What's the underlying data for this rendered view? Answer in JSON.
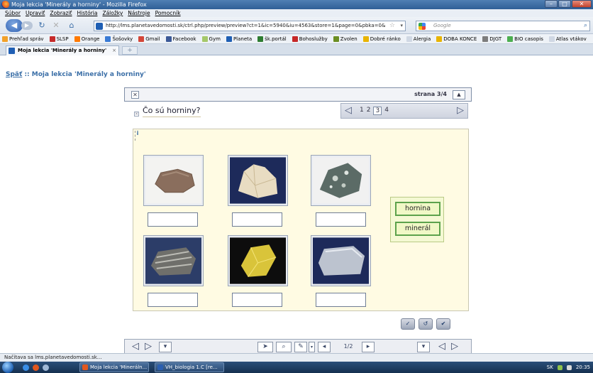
{
  "window": {
    "title": "Moja lekcia 'Minerály a horniny' - Mozilla Firefox",
    "min_btn": "–",
    "max_btn": "□",
    "close_btn": "✕"
  },
  "menu": [
    "Súbor",
    "Upraviť",
    "Zobraziť",
    "História",
    "Záložky",
    "Nástroje",
    "Pomocník"
  ],
  "nav": {
    "url": "http://lms.planetavedomosti.sk/ctrl.php/preview/preview?ct=1&ic=5940&iu=4563&store=1&page=0&pbka=0&",
    "search_placeholder": "Google"
  },
  "bookmarks": [
    {
      "label": "Prehľad správ",
      "color": "#f2a12a"
    },
    {
      "label": "SLSP",
      "color": "#c62a2a"
    },
    {
      "label": "Orange",
      "color": "#ff7a00"
    },
    {
      "label": "Šošovky",
      "color": "#3a7bd5"
    },
    {
      "label": "Gmail",
      "color": "#d44638"
    },
    {
      "label": "Facebook",
      "color": "#3b5998"
    },
    {
      "label": "Gym",
      "color": "#a5c86a"
    },
    {
      "label": "Planeta",
      "color": "#1f5fb4"
    },
    {
      "label": "šk.portál",
      "color": "#2e7d32"
    },
    {
      "label": "Bohoslužby",
      "color": "#c62828"
    },
    {
      "label": "Zvolen",
      "color": "#6b8e23"
    },
    {
      "label": "Dobré ránko",
      "color": "#e8b400"
    },
    {
      "label": "Alergia",
      "color": "#d0d8e4"
    },
    {
      "label": "DOBA KONCE",
      "color": "#e8b400"
    },
    {
      "label": "DJGT",
      "color": "#7d7d7d"
    },
    {
      "label": "BIO casopis",
      "color": "#4caf50"
    },
    {
      "label": "Atlas vtákov",
      "color": "#d0d8e4"
    }
  ],
  "tab": {
    "label": "Moja lekcia 'Minerály a horniny'",
    "new_tab": "+"
  },
  "page": {
    "back_link": "Späť",
    "breadcrumb_rest": " :: Moja lekcia 'Minerály a horniny'"
  },
  "lesson": {
    "page_label": "strana  3/4",
    "question": "Čo sú horniny?",
    "pages": [
      "1",
      "2",
      "3",
      "4"
    ],
    "current_page": "3",
    "info_icon": "i",
    "choices": [
      "hornina",
      "minerál"
    ],
    "rocks": [
      {
        "name": "rock-image-1",
        "bg": "#f3f3f1",
        "color": "#8a6e5d"
      },
      {
        "name": "rock-image-2",
        "bg": "#1d2a5a",
        "color": "#e8dcc2"
      },
      {
        "name": "rock-image-3",
        "bg": "#f1f1f1",
        "color": "#5b6b66"
      },
      {
        "name": "rock-image-4",
        "bg": "#2c3d68",
        "color": "#6f6f6b"
      },
      {
        "name": "rock-image-5",
        "bg": "#0d0d0d",
        "color": "#d9c43a"
      },
      {
        "name": "rock-image-6",
        "bg": "#1d2a5a",
        "color": "#bcc3cf"
      }
    ]
  },
  "bottombar": {
    "counter": "1/2"
  },
  "status": "Načítava sa lms.planetavedomosti.sk...",
  "taskbar": {
    "tasks": [
      "Moja lekcia 'Mineráln...",
      "VH_biologia 1.C [re..."
    ],
    "lang": "SK",
    "time": "20:35"
  }
}
